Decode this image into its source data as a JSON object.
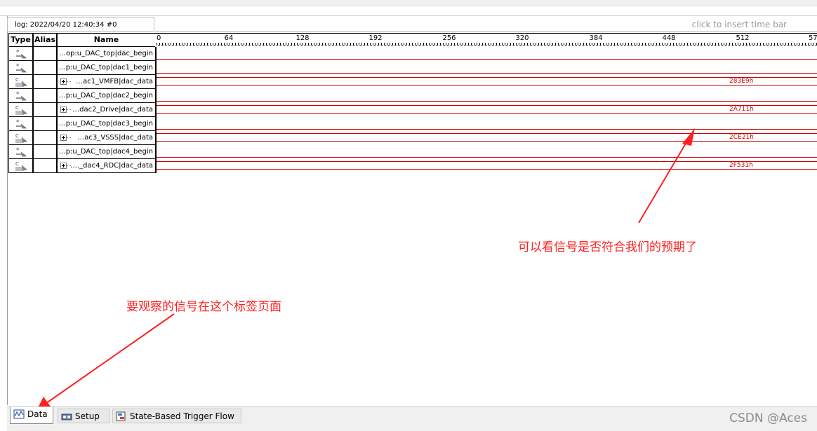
{
  "log_label": "log: 2022/04/20 12:40:34  #0",
  "timebar_hint": "click to insert time bar",
  "headers": {
    "type": "Type",
    "alias": "Alias",
    "name": "Name"
  },
  "ruler_ticks": [
    "0",
    "64",
    "128",
    "192",
    "256",
    "320",
    "384",
    "448",
    "512",
    "57"
  ],
  "signals": [
    {
      "name": "…op:u_DAC_top|dac_begin",
      "kind": "bit",
      "value": ""
    },
    {
      "name": "…p:u_DAC_top|dac1_begin",
      "kind": "bit",
      "value": ""
    },
    {
      "name": "…ac1_VMFB|dac_data",
      "kind": "bus",
      "value": "283E9h"
    },
    {
      "name": "…p:u_DAC_top|dac2_begin",
      "kind": "bit",
      "value": ""
    },
    {
      "name": "…dac2_Drive|dac_data",
      "kind": "bus",
      "value": "2A711h"
    },
    {
      "name": "…p:u_DAC_top|dac3_begin",
      "kind": "bit",
      "value": ""
    },
    {
      "name": "…ac3_VSSS|dac_data",
      "kind": "bus",
      "value": "2CE21h"
    },
    {
      "name": "…p:u_DAC_top|dac4_begin",
      "kind": "bit",
      "value": ""
    },
    {
      "name": "…._dac4_RDC|dac_data",
      "kind": "bus",
      "value": "2F531h"
    }
  ],
  "annotations": {
    "signals_note": "可以看信号是否符合我们的预期了",
    "tab_note": "要观察的信号在这个标签页面"
  },
  "tabs": [
    {
      "label": "Data",
      "icon": "data-icon",
      "active": true
    },
    {
      "label": "Setup",
      "icon": "setup-icon",
      "active": false
    },
    {
      "label": "State-Based Trigger Flow",
      "icon": "trigger-flow-icon",
      "active": false
    }
  ],
  "watermark": "CSDN @Aces",
  "colors": {
    "waveform": "#d00000",
    "annotation": "#ff2020"
  }
}
